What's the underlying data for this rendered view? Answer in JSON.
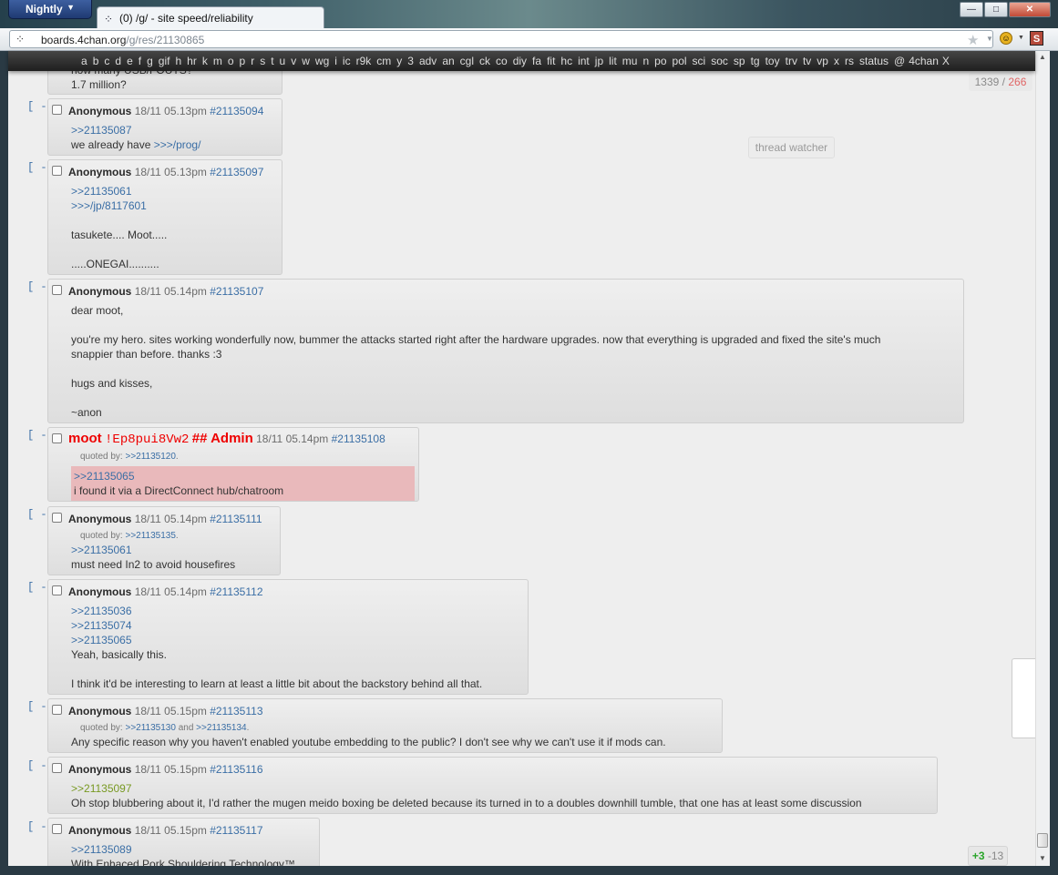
{
  "browser": {
    "app_button": "Nightly",
    "tab_title": "(0) /g/ - site speed/reliability",
    "url_host": "boards.4chan.org",
    "url_path": "/g/res/21130865",
    "icons": [
      "four-squares-icon",
      "star-icon",
      "addon-icon",
      "stylish-icon"
    ],
    "window_buttons": [
      "minimize",
      "maximize",
      "close"
    ]
  },
  "boardbar": {
    "boards": [
      "a",
      "b",
      "c",
      "d",
      "e",
      "f",
      "g",
      "gif",
      "h",
      "hr",
      "k",
      "m",
      "o",
      "p",
      "r",
      "s",
      "t",
      "u",
      "v",
      "w",
      "wg",
      "i",
      "ic",
      "r9k",
      "cm",
      "y",
      "3",
      "adv",
      "an",
      "cgl",
      "ck",
      "co",
      "diy",
      "fa",
      "fit",
      "hc",
      "int",
      "jp",
      "lit",
      "mu",
      "n",
      "po",
      "pol",
      "sci",
      "soc",
      "sp",
      "tg",
      "toy",
      "trv",
      "tv",
      "vp",
      "x",
      "rs",
      "status",
      "@"
    ],
    "home": "4chan",
    "close": "X"
  },
  "counter": {
    "posts": "1339",
    "sep": " / ",
    "total": "266"
  },
  "watcher": "thread watcher",
  "updater": {
    "up": "+3",
    "down": "-13"
  },
  "hide_label": "[ - ]",
  "posts": [
    {
      "partial_lines": [
        "how many USB/FOUTS?",
        "1.7 million?"
      ]
    },
    {
      "name": "Anonymous",
      "date": "18/11 05.13pm",
      "no": "#21135094",
      "lines": [
        ">>21135087",
        "we already have ",
        ">>>/prog/"
      ]
    },
    {
      "name": "Anonymous",
      "date": "18/11 05.13pm",
      "no": "#21135097",
      "lines": [
        ">>21135061",
        ">>>/jp/8117601",
        "tasukete.... Moot.....",
        ".....ONEGAI.........."
      ]
    },
    {
      "name": "Anonymous",
      "date": "18/11 05.14pm",
      "no": "#21135107",
      "lines": [
        "dear moot,",
        "you're my hero. sites working wonderfully now, bummer the attacks started right after the hardware upgrades. now that everything is upgraded and fixed the site's much",
        "snappier than before. thanks :3",
        "hugs and kisses,",
        "~anon"
      ]
    },
    {
      "name": "moot",
      "trip": "!Ep8pui8Vw2",
      "capcode": "## Admin",
      "date": "18/11 05.14pm",
      "no": "#21135108",
      "quoted_by": "quoted by: ",
      "qb1": ">>21135120",
      "qb_end": ".",
      "lines": [
        ">>21135065",
        "i found it via a DirectConnect hub/chatroom"
      ]
    },
    {
      "name": "Anonymous",
      "date": "18/11 05.14pm",
      "no": "#21135111",
      "quoted_by": "quoted by: ",
      "qb1": ">>21135135",
      "qb_end": ".",
      "lines": [
        ">>21135061",
        "must need In2 to avoid housefires"
      ]
    },
    {
      "name": "Anonymous",
      "date": "18/11 05.14pm",
      "no": "#21135112",
      "lines": [
        ">>21135036",
        ">>21135074",
        ">>21135065",
        "Yeah, basically this.",
        "I think it'd be interesting to learn at least a little bit about the backstory behind all that."
      ]
    },
    {
      "name": "Anonymous",
      "date": "18/11 05.15pm",
      "no": "#21135113",
      "quoted_by": "quoted by: ",
      "qb1": ">>21135130",
      "qb_and": " and ",
      "qb2": ">>21135134",
      "qb_end": ".",
      "lines": [
        "Any specific reason why you haven't enabled youtube embedding to the public? I don't see why we can't use it if mods can."
      ]
    },
    {
      "name": "Anonymous",
      "date": "18/11 05.15pm",
      "no": "#21135116",
      "lines": [
        ">>21135097",
        "Oh stop blubbering about it, I'd rather the mugen meido boxing be deleted because its turned in to a doubles downhill tumble, that one has at least some discussion"
      ]
    },
    {
      "name": "Anonymous",
      "date": "18/11 05.15pm",
      "no": "#21135117",
      "lines": [
        ">>21135089",
        "With Enhaced Pork Shouldering Technology™"
      ]
    }
  ]
}
